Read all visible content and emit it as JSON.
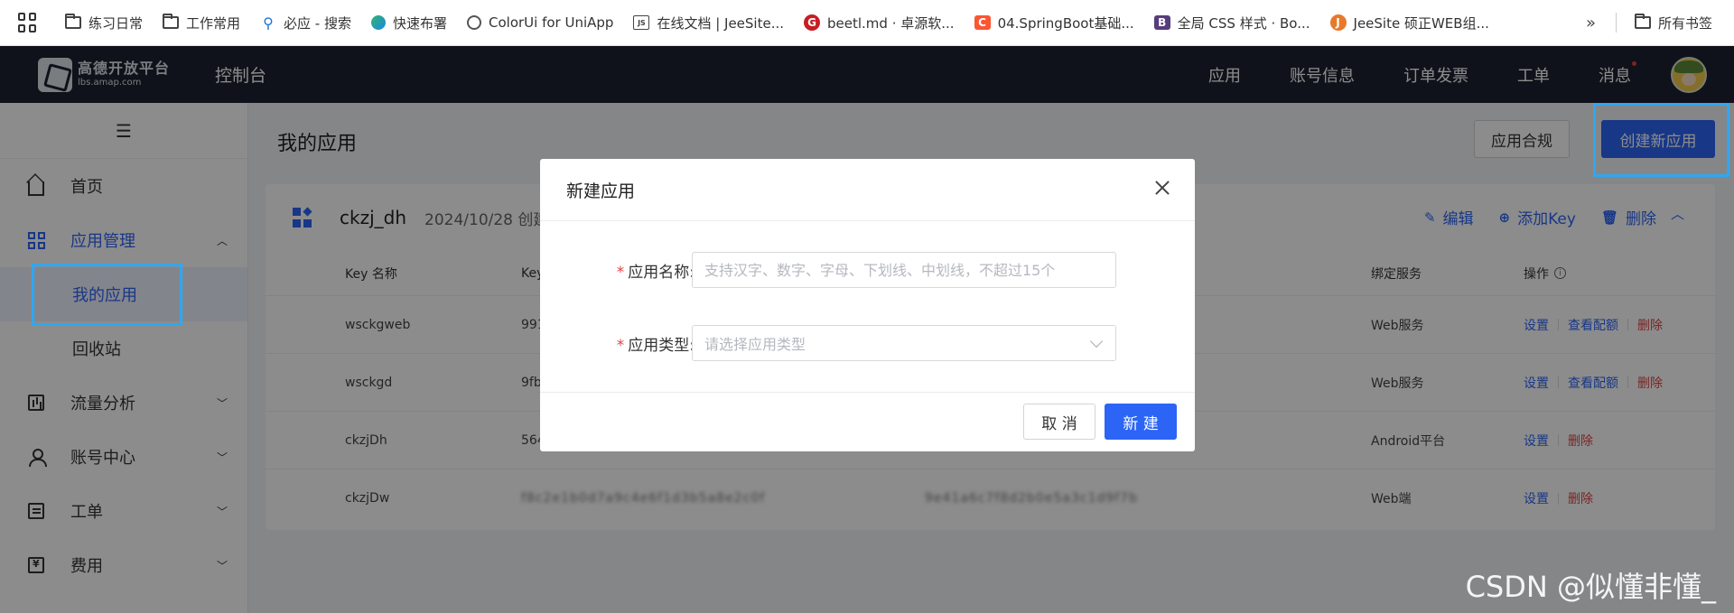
{
  "bookmarks": {
    "items": [
      {
        "label": "练习日常",
        "icon": "folder-icon"
      },
      {
        "label": "工作常用",
        "icon": "folder-icon"
      },
      {
        "label": "必应 - 搜索",
        "icon": "search-icon"
      },
      {
        "label": "快速布署",
        "icon": "edge-icon"
      },
      {
        "label": "ColorUi for UniApp",
        "icon": "globe-icon"
      },
      {
        "label": "在线文档 | JeeSite...",
        "icon": "js-icon"
      },
      {
        "label": "beetl.md · 卓源软...",
        "icon": "gitee-icon"
      },
      {
        "label": "04.SpringBoot基础...",
        "icon": "csdn-icon"
      },
      {
        "label": "全局 CSS 样式 · Bo...",
        "icon": "bootstrap-icon"
      },
      {
        "label": "JeeSite 硕正WEB组...",
        "icon": "jeesite-icon"
      }
    ],
    "more": "»",
    "all_bookmarks": "所有书签"
  },
  "topnav": {
    "logo_title": "高德开放平台",
    "logo_sub": "lbs.amap.com",
    "console": "控制台",
    "items": [
      "应用",
      "账号信息",
      "订单发票",
      "工单",
      "消息"
    ]
  },
  "sidebar": {
    "toggle": "☰",
    "home": "首页",
    "app_manage": "应用管理",
    "my_apps": "我的应用",
    "recycle": "回收站",
    "traffic": "流量分析",
    "account": "账号中心",
    "ticket": "工单",
    "fee": "费用"
  },
  "main": {
    "title": "我的应用",
    "comply_button": "应用合规",
    "create_button": "创建新应用"
  },
  "card": {
    "app_name": "ckzj_dh",
    "date": "2024/10/28 创建",
    "edit": "编辑",
    "add_key": "添加Key",
    "delete": "删除",
    "columns": {
      "name": "Key 名称",
      "key": "Key",
      "service": "绑定服务",
      "op": "操作"
    },
    "rows": [
      {
        "name": "wsckgweb",
        "key": "991",
        "secret": "",
        "service": "Web服务",
        "ops": [
          "设置",
          "查看配额",
          "删除"
        ]
      },
      {
        "name": "wsckgd",
        "key": "9fb",
        "secret": "",
        "service": "Web服务",
        "ops": [
          "设置",
          "查看配额",
          "删除"
        ]
      },
      {
        "name": "ckzjDh",
        "key": "564",
        "secret": "",
        "service": "Android平台",
        "ops": [
          "设置",
          "删除"
        ]
      },
      {
        "name": "ckzjDw",
        "key": "f8c2e1b0d7a9c4e6f1d3b5a8e2c0f",
        "secret": "9e41a6c7f8d2b0e5a3c1d9f7b",
        "service": "Web端",
        "ops": [
          "设置",
          "删除"
        ]
      }
    ]
  },
  "dialog": {
    "title": "新建应用",
    "name_label": "应用名称:",
    "name_placeholder": "支持汉字、数字、字母、下划线、中划线，不超过15个",
    "type_label": "应用类型:",
    "type_placeholder": "请选择应用类型",
    "required_mark": "*",
    "cancel": "取 消",
    "ok": "新 建"
  },
  "watermark": "CSDN @似懂非懂_",
  "colors": {
    "accent": "#2c64f5",
    "nav_bg": "#1d2230",
    "highlight": "#2fa7f2",
    "danger": "#e04444"
  }
}
